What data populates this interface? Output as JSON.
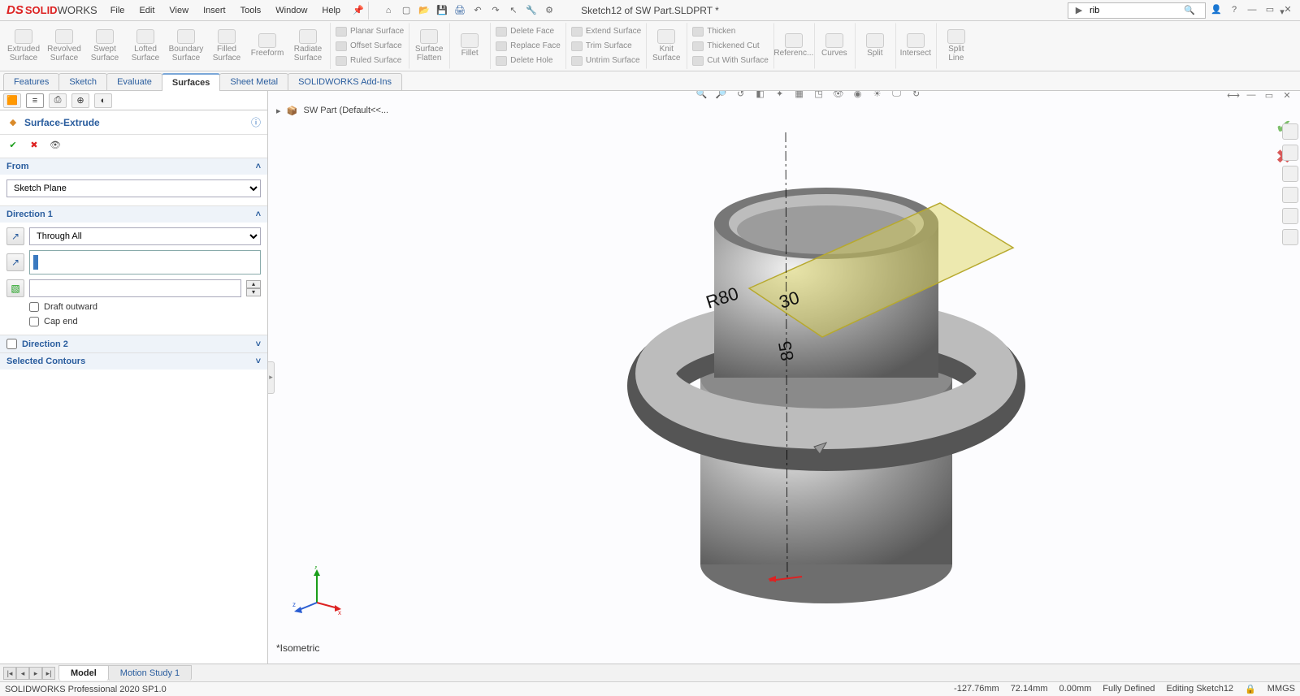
{
  "app": {
    "logo_brand": "SOLID",
    "logo_brand2": "WORKS",
    "document_title": "Sketch12 of SW Part.SLDPRT *",
    "search_value": "rib"
  },
  "menubar": [
    "File",
    "Edit",
    "View",
    "Insert",
    "Tools",
    "Window",
    "Help"
  ],
  "ribbon_big": [
    "Extruded Surface",
    "Revolved Surface",
    "Swept Surface",
    "Lofted Surface",
    "Boundary Surface",
    "Filled Surface",
    "Freeform",
    "Radiate Surface"
  ],
  "ribbon_groups": [
    {
      "lines": [
        "Planar Surface",
        "Offset Surface",
        "Ruled Surface"
      ]
    },
    {
      "big": "Surface Flatten"
    },
    {
      "big": "Fillet"
    },
    {
      "lines": [
        "Delete Face",
        "Replace Face",
        "Delete Hole"
      ]
    },
    {
      "lines": [
        "Extend Surface",
        "Trim Surface",
        "Untrim Surface"
      ]
    },
    {
      "big": "Knit Surface"
    },
    {
      "lines": [
        "Thicken",
        "Thickened Cut",
        "Cut With Surface"
      ]
    },
    {
      "big": "Referenc..."
    },
    {
      "big": "Curves"
    },
    {
      "big": "Split"
    },
    {
      "big": "Intersect"
    },
    {
      "big": "Split Line"
    }
  ],
  "task_tabs": [
    "Features",
    "Sketch",
    "Evaluate",
    "Surfaces",
    "Sheet Metal",
    "SOLIDWORKS Add-Ins"
  ],
  "task_tabs_active": 3,
  "breadcrumb": "SW Part  (Default<<...",
  "property_manager": {
    "title": "Surface-Extrude",
    "sections": {
      "from": {
        "label": "From",
        "combo": "Sketch Plane"
      },
      "dir1": {
        "label": "Direction 1",
        "combo": "Through All",
        "draft_value": "",
        "depth_input": "",
        "chk_draft_outward": "Draft outward",
        "chk_cap_end": "Cap end"
      },
      "dir2": {
        "label": "Direction 2"
      },
      "contours": {
        "label": "Selected Contours"
      }
    }
  },
  "viewport": {
    "iso_label": "*Isometric",
    "dim_r": "R80",
    "dim_30": "30",
    "dim_85": "85"
  },
  "doc_tabs": [
    "Model",
    "Motion Study 1"
  ],
  "doc_tabs_active": 0,
  "status": {
    "left": "SOLIDWORKS Professional 2020 SP1.0",
    "coord_x": "-127.76mm",
    "coord_y": "72.14mm",
    "coord_z": "0.00mm",
    "state": "Fully Defined",
    "context": "Editing Sketch12",
    "units": "MMGS"
  }
}
